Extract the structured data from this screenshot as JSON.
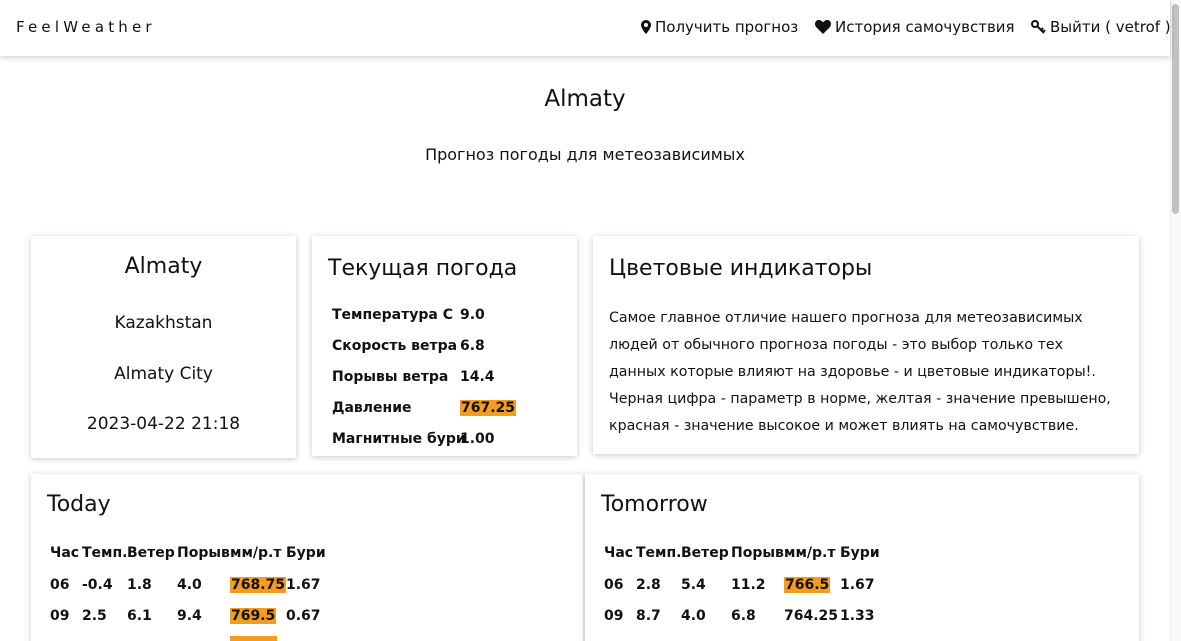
{
  "navbar": {
    "brand": "FeelWeather",
    "get_forecast": "Получить прогноз",
    "history": "История самочувствия",
    "logout": "Выйти ( vetrof )"
  },
  "page": {
    "title": "Almaty",
    "subtitle": "Прогноз погоды для метеозависимых"
  },
  "location_card": {
    "city": "Almaty",
    "country": "Kazakhstan",
    "region": "Almaty City",
    "datetime": "2023-04-22 21:18"
  },
  "current_weather": {
    "heading": "Текущая погода",
    "rows": [
      {
        "label": "Температура С",
        "value": "9.0",
        "highlight": false
      },
      {
        "label": "Скорость ветра",
        "value": "6.8",
        "highlight": false
      },
      {
        "label": "Порывы ветра",
        "value": "14.4",
        "highlight": false
      },
      {
        "label": "Давление",
        "value": "767.25",
        "highlight": true
      },
      {
        "label": "Магнитные бури",
        "value": "1.00",
        "highlight": false
      }
    ]
  },
  "indicators": {
    "heading": "Цветовые индикаторы",
    "text": "Самое главное отличие нашего прогноза для метеозависимых людей от обычного прогноза погоды - это выбор только тех данных которые влияют на здоровье - и цветовые индикаторы!. Черная цифра - параметр в норме, желтая - значение превышено, красная - значение высокое и может влиять на самочувствие."
  },
  "colors": {
    "highlight_yellow": "#f39c1e",
    "text": "#111111"
  },
  "table_headers": {
    "hour": "Час",
    "temp": "Темп.",
    "wind": "Ветер",
    "gust": "Порыв",
    "pressure": "мм/р.т",
    "storms": "Бури"
  },
  "today": {
    "heading": "Today",
    "rows": [
      {
        "hour": "06",
        "temp": "-0.4",
        "wind": "1.8",
        "gust": "4.0",
        "pressure": "768.75",
        "pressure_highlight": true,
        "storms": "1.67"
      },
      {
        "hour": "09",
        "temp": "2.5",
        "wind": "6.1",
        "gust": "9.4",
        "pressure": "769.5",
        "pressure_highlight": true,
        "storms": "0.67"
      }
    ]
  },
  "tomorrow": {
    "heading": "Tomorrow",
    "rows": [
      {
        "hour": "06",
        "temp": "2.8",
        "wind": "5.4",
        "gust": "11.2",
        "pressure": "766.5",
        "pressure_highlight": true,
        "storms": "1.67"
      },
      {
        "hour": "09",
        "temp": "8.7",
        "wind": "4.0",
        "gust": "6.8",
        "pressure": "764.25",
        "pressure_highlight": false,
        "storms": "1.33"
      }
    ]
  }
}
